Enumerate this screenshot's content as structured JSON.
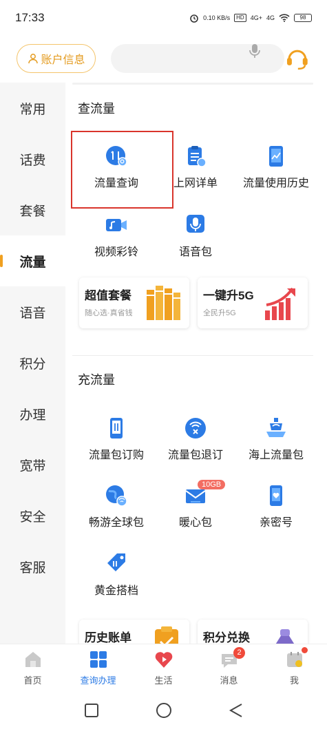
{
  "status": {
    "time": "17:33",
    "net_speed": "0.10 KB/s",
    "hd": "HD",
    "sig1": "4G+",
    "sig2": "4G",
    "battery": "98"
  },
  "header": {
    "account_label": "账户信息",
    "search_placeholder": ""
  },
  "sidebar": {
    "items": [
      {
        "label": "常用"
      },
      {
        "label": "话费"
      },
      {
        "label": "套餐"
      },
      {
        "label": "流量",
        "active": true
      },
      {
        "label": "语音"
      },
      {
        "label": "积分"
      },
      {
        "label": "办理"
      },
      {
        "label": "宽带"
      },
      {
        "label": "安全"
      },
      {
        "label": "客服"
      }
    ]
  },
  "section1": {
    "title": "查流量",
    "items": [
      {
        "label": "流量查询",
        "icon": "data-query-icon"
      },
      {
        "label": "上网详单",
        "icon": "data-detail-icon"
      },
      {
        "label": "流量使用历史",
        "icon": "usage-history-icon"
      },
      {
        "label": "视频彩铃",
        "icon": "video-ringtone-icon"
      },
      {
        "label": "语音包",
        "icon": "voice-pack-icon"
      }
    ],
    "promos": [
      {
        "title": "超值套餐",
        "subtitle": "随心选·真省钱"
      },
      {
        "title": "一键升5G",
        "subtitle": "全民升5G"
      }
    ]
  },
  "section2": {
    "title": "充流量",
    "items": [
      {
        "label": "流量包订购",
        "icon": "data-pack-order-icon"
      },
      {
        "label": "流量包退订",
        "icon": "data-pack-unsubscribe-icon"
      },
      {
        "label": "海上流量包",
        "icon": "sea-data-pack-icon"
      },
      {
        "label": "畅游全球包",
        "icon": "global-roaming-icon"
      },
      {
        "label": "暖心包",
        "icon": "warm-pack-icon",
        "badge": "10GB"
      },
      {
        "label": "亲密号",
        "icon": "intimate-number-icon"
      },
      {
        "label": "黄金搭档",
        "icon": "golden-partner-icon"
      }
    ],
    "promos": [
      {
        "title": "历史账单"
      },
      {
        "title": "积分兑换"
      }
    ]
  },
  "tabbar": {
    "tabs": [
      {
        "label": "首页"
      },
      {
        "label": "查询办理",
        "active": true
      },
      {
        "label": "生活"
      },
      {
        "label": "消息",
        "badge": "2"
      },
      {
        "label": "我"
      }
    ]
  },
  "colors": {
    "accent_blue": "#2c7be5",
    "accent_orange": "#f0a020",
    "highlight_red": "#d9342b"
  }
}
